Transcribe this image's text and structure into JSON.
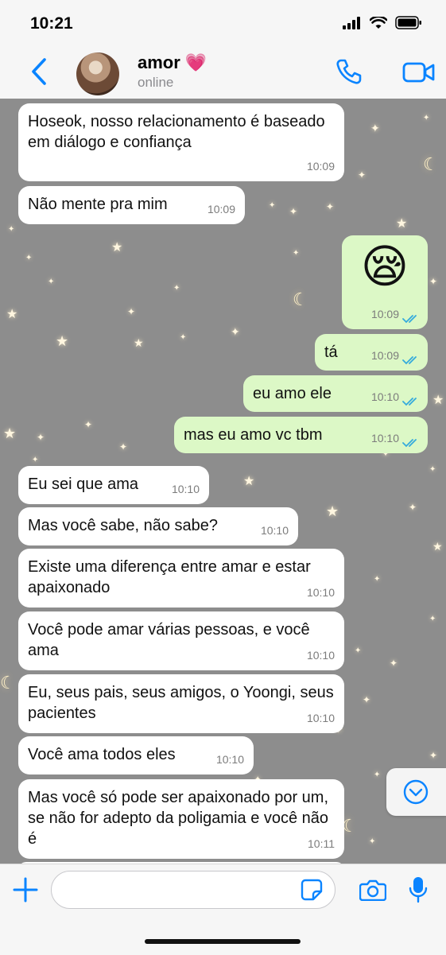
{
  "status_bar": {
    "time": "10:21"
  },
  "header": {
    "contact_name": "amor 💗",
    "contact_status": "online"
  },
  "messages": [
    {
      "dir": "in",
      "text": "Hoseok, nosso relacionamento é baseado em diálogo e confiança",
      "time": "10:09"
    },
    {
      "dir": "in",
      "text": "Não mente pra mim",
      "time": "10:09"
    },
    {
      "dir": "out",
      "text": "😪",
      "time": "10:09",
      "read": true
    },
    {
      "dir": "out",
      "text": "tá",
      "time": "10:09",
      "read": true
    },
    {
      "dir": "out",
      "text": "eu amo ele",
      "time": "10:10",
      "read": true
    },
    {
      "dir": "out",
      "text": "mas eu amo vc tbm",
      "time": "10:10",
      "read": true
    },
    {
      "dir": "in",
      "text": "Eu sei que ama",
      "time": "10:10"
    },
    {
      "dir": "in",
      "text": "Mas você sabe, não sabe?",
      "time": "10:10"
    },
    {
      "dir": "in",
      "text": "Existe uma diferença entre amar e estar apaixonado",
      "time": "10:10"
    },
    {
      "dir": "in",
      "text": "Você pode amar várias pessoas, e você ama",
      "time": "10:10"
    },
    {
      "dir": "in",
      "text": "Eu, seus pais, seus amigos, o Yoongi, seus pacientes",
      "time": "10:10"
    },
    {
      "dir": "in",
      "text": "Você ama todos eles",
      "time": "10:10"
    },
    {
      "dir": "in",
      "text": "Mas você só pode ser apaixonado por um, se não for adepto da poligamia e você não é",
      "time": "10:11"
    }
  ],
  "colors": {
    "accent": "#0a84ff",
    "incoming_bubble": "#ffffff",
    "outgoing_bubble": "#dcf8c6",
    "read_ticks": "#34aadc"
  },
  "icons": [
    "back-chevron-icon",
    "phone-icon",
    "video-camera-icon",
    "chevron-down-circle-icon",
    "plus-icon",
    "sticker-icon",
    "camera-icon",
    "microphone-icon"
  ]
}
